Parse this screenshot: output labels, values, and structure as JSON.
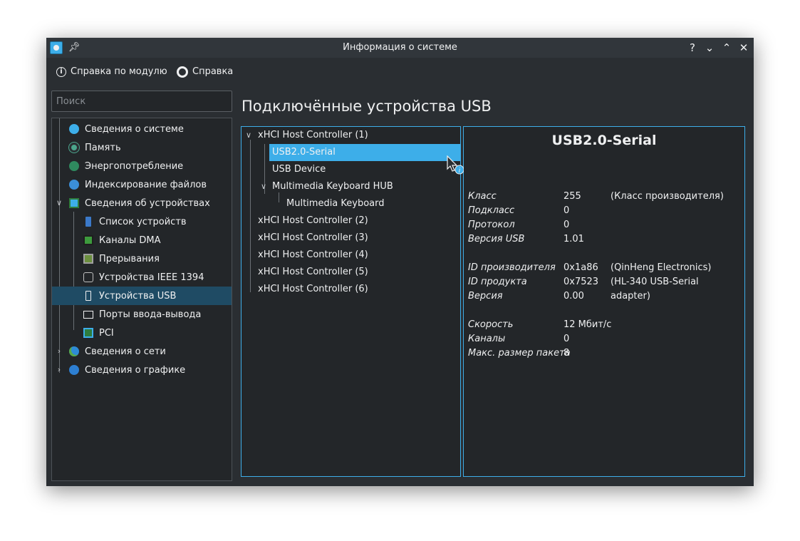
{
  "window": {
    "title": "Информация о системе",
    "controls": [
      "?",
      "⌄",
      "⌃",
      "✕"
    ]
  },
  "toolbar": {
    "module_help_label": "Справка по модулю",
    "help_label": "Справка"
  },
  "search": {
    "placeholder": "Поиск"
  },
  "sidebar": {
    "items": [
      {
        "label": "Сведения о системе",
        "icon": "info-icon"
      },
      {
        "label": "Память",
        "icon": "memory-icon"
      },
      {
        "label": "Энергопотребление",
        "icon": "power-icon"
      },
      {
        "label": "Индексирование файлов",
        "icon": "file-index-icon"
      },
      {
        "label": "Сведения об устройствах",
        "icon": "devices-icon",
        "expanded": true
      },
      {
        "label": "Список устройств",
        "icon": "usb-stick-icon"
      },
      {
        "label": "Каналы DMA",
        "icon": "dma-icon"
      },
      {
        "label": "Прерывания",
        "icon": "interrupts-icon"
      },
      {
        "label": "Устройства IEEE 1394",
        "icon": "firewire-icon"
      },
      {
        "label": "Устройства USB",
        "icon": "usb-icon",
        "selected": true
      },
      {
        "label": "Порты ввода-вывода",
        "icon": "monitor-icon"
      },
      {
        "label": "PCI",
        "icon": "pci-icon"
      },
      {
        "label": "Сведения о сети",
        "icon": "globe-icon",
        "expanded": false
      },
      {
        "label": "Сведения о графике",
        "icon": "graphics-icon",
        "expanded": false
      }
    ]
  },
  "main": {
    "heading": "Подключённые устройства USB",
    "tree": [
      {
        "label": "xHCI Host Controller (1)",
        "level": 0,
        "expanded": true
      },
      {
        "label": "USB2.0-Serial",
        "level": 1,
        "selected": true
      },
      {
        "label": "USB Device",
        "level": 1
      },
      {
        "label": "Multimedia Keyboard HUB",
        "level": 1,
        "expanded": true
      },
      {
        "label": "Multimedia Keyboard",
        "level": 2
      },
      {
        "label": "xHCI Host Controller (2)",
        "level": 0
      },
      {
        "label": "xHCI Host Controller (3)",
        "level": 0
      },
      {
        "label": "xHCI Host Controller (4)",
        "level": 0
      },
      {
        "label": "xHCI Host Controller (5)",
        "level": 0
      },
      {
        "label": "xHCI Host Controller (6)",
        "level": 0
      }
    ],
    "details": {
      "title": "USB2.0-Serial",
      "rows": [
        {
          "key": "Класс",
          "value": "255",
          "desc": "(Класс производителя)"
        },
        {
          "key": "Подкласс",
          "value": "0",
          "desc": ""
        },
        {
          "key": "Протокол",
          "value": "0",
          "desc": ""
        },
        {
          "key": "Версия USB",
          "value": "1.01",
          "desc": ""
        },
        {
          "key": "ID производителя",
          "value": "0x1a86",
          "desc": "(QinHeng Electronics)"
        },
        {
          "key": "ID продукта",
          "value": "0x7523",
          "desc": "(HL-340 USB-Serial adapter)"
        },
        {
          "key": "Версия",
          "value": "0.00",
          "desc": ""
        },
        {
          "key": "Скорость",
          "value": "12 Мбит/с",
          "desc": ""
        },
        {
          "key": "Каналы",
          "value": "0",
          "desc": ""
        },
        {
          "key": "Макс. размер пакета",
          "value": "8",
          "desc": ""
        }
      ]
    }
  },
  "colors": {
    "accent": "#3daee9",
    "window_bg": "#2a2e32",
    "panel_bg": "#232629",
    "sidebar_selected": "#1f4b64",
    "text": "#eff0f1"
  }
}
